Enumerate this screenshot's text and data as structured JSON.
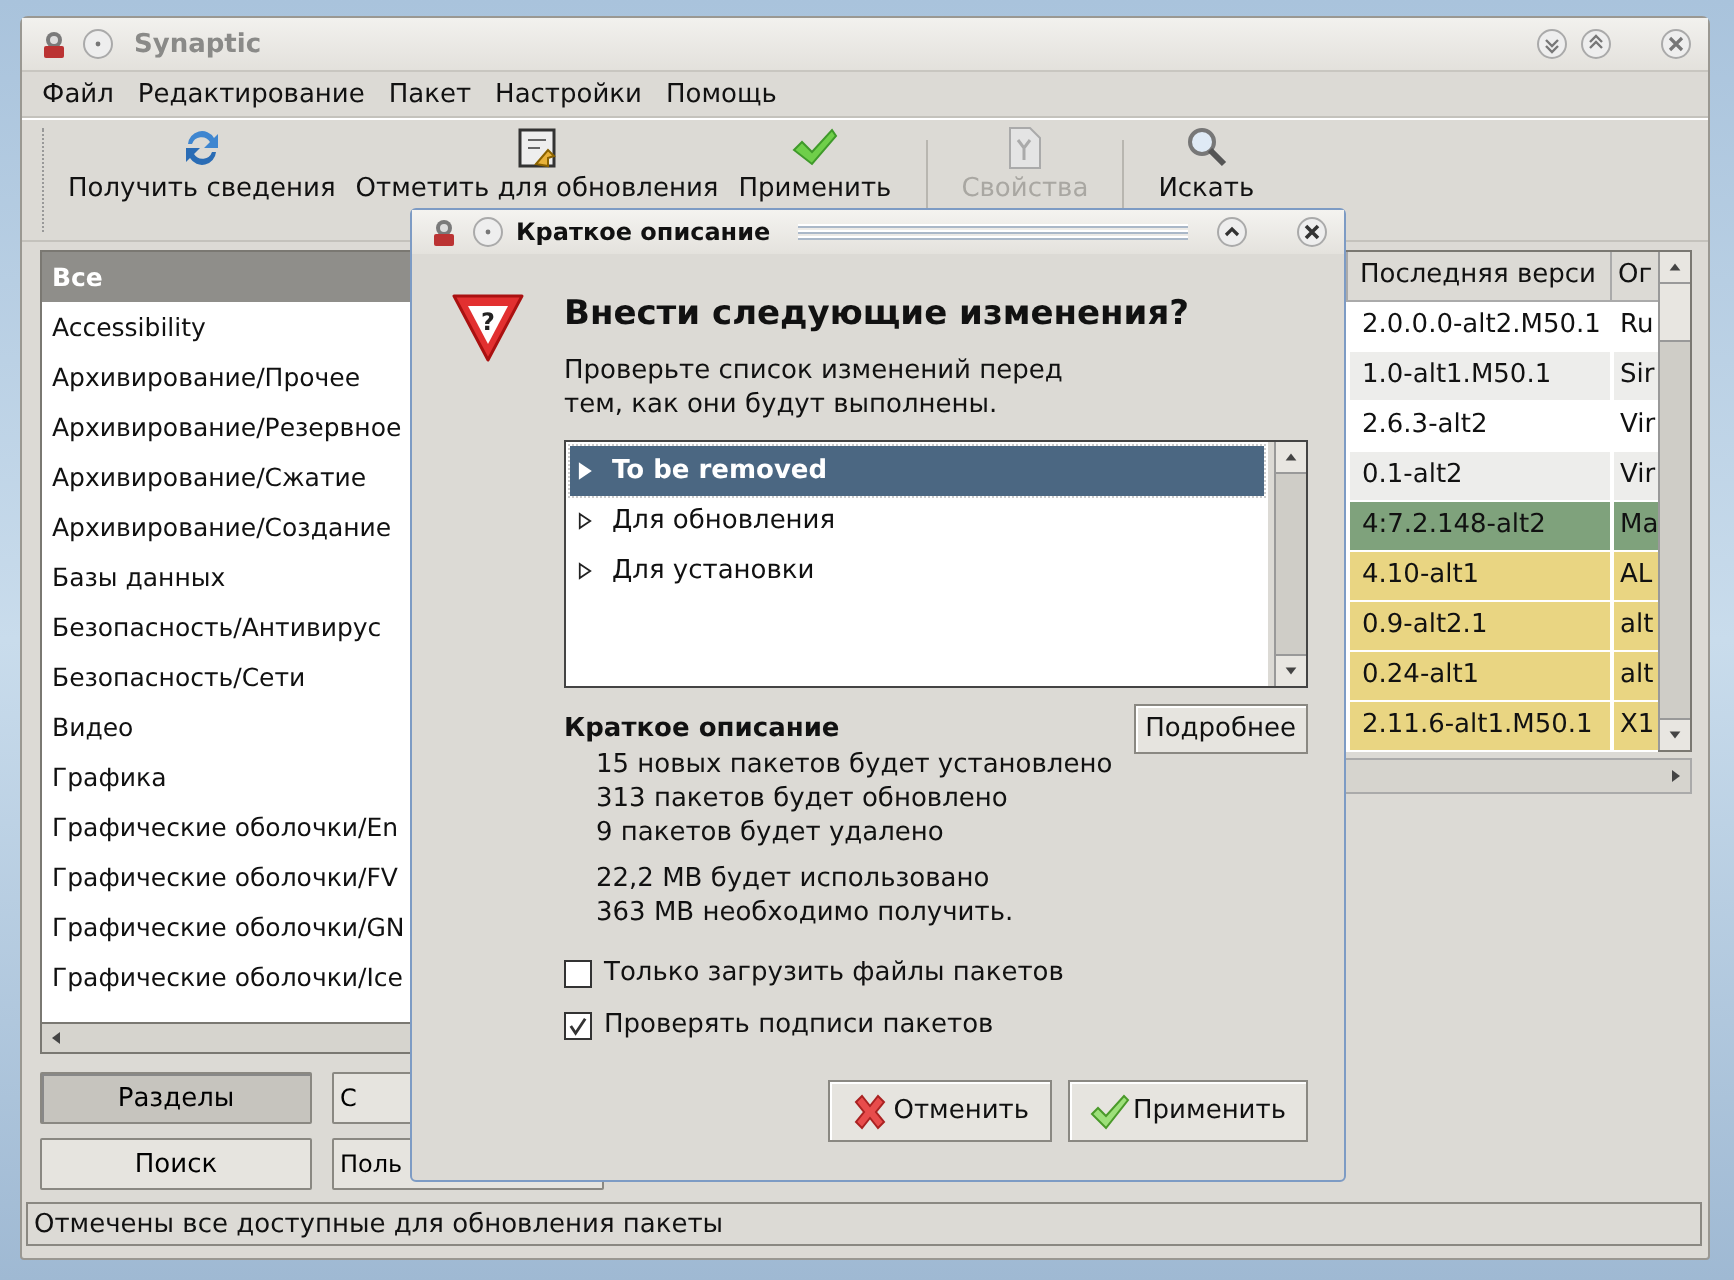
{
  "window": {
    "title": "Synaptic"
  },
  "menu": [
    "Файл",
    "Редактирование",
    "Пакет",
    "Настройки",
    "Помощь"
  ],
  "toolbar": [
    {
      "kind": "reload",
      "label": "Получить сведения",
      "disabled": false
    },
    {
      "kind": "mark",
      "label": "Отметить для обновления",
      "disabled": false
    },
    {
      "kind": "apply",
      "label": "Применить",
      "disabled": false
    },
    {
      "kind": "separator"
    },
    {
      "kind": "properties",
      "label": "Свойства",
      "disabled": true
    },
    {
      "kind": "separator"
    },
    {
      "kind": "search",
      "label": "Искать",
      "disabled": false
    }
  ],
  "sections": [
    {
      "label": "Все",
      "selected": true
    },
    {
      "label": "Accessibility",
      "selected": false
    },
    {
      "label": "Архивирование/Прочее",
      "selected": false
    },
    {
      "label": "Архивирование/Резервное",
      "selected": false
    },
    {
      "label": "Архивирование/Сжатие",
      "selected": false
    },
    {
      "label": "Архивирование/Создание",
      "selected": false
    },
    {
      "label": "Базы данных",
      "selected": false
    },
    {
      "label": "Безопасность/Антивирус",
      "selected": false
    },
    {
      "label": "Безопасность/Сети",
      "selected": false
    },
    {
      "label": "Видео",
      "selected": false
    },
    {
      "label": "Графика",
      "selected": false
    },
    {
      "label": "Графические оболочки/En",
      "selected": false
    },
    {
      "label": "Графические оболочки/FV",
      "selected": false
    },
    {
      "label": "Графические оболочки/GN",
      "selected": false
    },
    {
      "label": "Графические оболочки/Ice",
      "selected": false
    }
  ],
  "filter_buttons": [
    {
      "label": "Разделы",
      "selected": true
    },
    {
      "label": "С",
      "selected": false
    },
    {
      "label": "Поиск",
      "selected": false
    },
    {
      "label": "Поль",
      "selected": false
    }
  ],
  "packages": {
    "columns": [
      "Последняя верси",
      "Ог"
    ],
    "rows": [
      {
        "version": "2.0.0.0-alt2.M50.1",
        "column_2": "Ru",
        "color": "#ffffff"
      },
      {
        "version": "1.0-alt1.M50.1",
        "column_2": "Sir",
        "color": "#ededeb"
      },
      {
        "version": "2.6.3-alt2",
        "column_2": "Vir",
        "color": "#ffffff"
      },
      {
        "version": "0.1-alt2",
        "column_2": "Vir",
        "color": "#ededeb"
      },
      {
        "version": "4:7.2.148-alt2",
        "column_2": "Ma",
        "color": "#7fa27c"
      },
      {
        "version": "4.10-alt1",
        "column_2": "AL",
        "color": "#e9d582"
      },
      {
        "version": "0.9-alt2.1",
        "column_2": "alt",
        "color": "#e9d582"
      },
      {
        "version": "0.24-alt1",
        "column_2": "alt",
        "color": "#e9d582"
      },
      {
        "version": "2.11.6-alt1.M50.1",
        "column_2": "X1",
        "color": "#e9d582"
      }
    ]
  },
  "status_bar": "Отмечены все доступные для обновления пакеты",
  "dialog": {
    "title": "Краткое описание",
    "icon_symbol": "?",
    "heading": "Внести следующие изменения?",
    "description": "Проверьте список изменений перед тем, как они будут выполнены.",
    "changes": [
      {
        "label": "To be removed",
        "selected": true
      },
      {
        "label": "Для обновления",
        "selected": false
      },
      {
        "label": "Для установки",
        "selected": false
      }
    ],
    "summary": {
      "title": "Краткое описание",
      "details_button": "Подробнее",
      "package_lines": [
        "15 новых пакетов будет установлено",
        "313 пакетов будет обновлено",
        "9 пакетов будет удалено"
      ],
      "size_lines": [
        "22,2 MB будет использовано",
        "363 MB необходимо получить."
      ]
    },
    "options": [
      {
        "label": "Только загрузить файлы пакетов",
        "checked": false
      },
      {
        "label": "Проверять подписи пакетов",
        "checked": true
      }
    ],
    "buttons": [
      {
        "kind": "cancel",
        "label": "Отменить"
      },
      {
        "kind": "apply",
        "label": "Применить"
      }
    ]
  }
}
